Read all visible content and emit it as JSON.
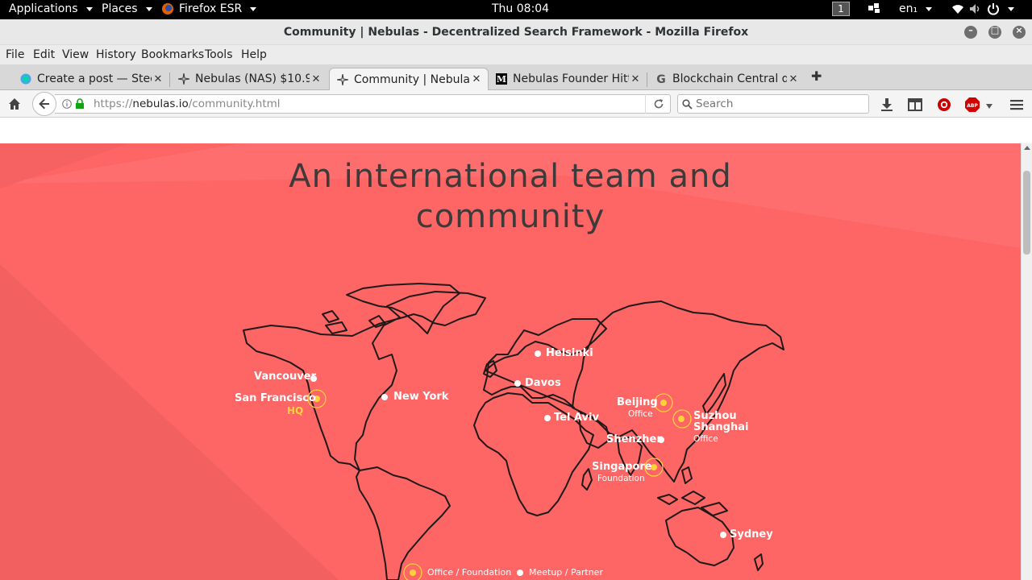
{
  "system_bar": {
    "applications": "Applications",
    "places": "Places",
    "firefox": "Firefox ESR",
    "clock": "Thu 08:04",
    "workspace": "1",
    "language": "en₁"
  },
  "window": {
    "title": "Community | Nebulas - Decentralized Search Framework - Mozilla Firefox"
  },
  "menu": [
    "File",
    "Edit",
    "View",
    "History",
    "Bookmarks",
    "Tools",
    "Help"
  ],
  "tabs": [
    {
      "label": "Create a post — Stee…",
      "icon": "steemit-icon"
    },
    {
      "label": "Nebulas (NAS) $10.9…",
      "icon": "nebulas-icon"
    },
    {
      "label": "Community | Nebulas…",
      "icon": "nebulas-icon",
      "active": true
    },
    {
      "label": "Nebulas Founder Hitt…",
      "icon": "medium-icon"
    },
    {
      "label": "Blockchain Central du…",
      "icon": "google-icon"
    }
  ],
  "navigation": {
    "url_prefix": "https://",
    "url_host": "nebulas.io",
    "url_path": "/community.html",
    "search_placeholder": "Search"
  },
  "page": {
    "heading_line1": "An international team and",
    "heading_line2": "community",
    "cities": {
      "vancouver": "Vancouver",
      "san_francisco": "San Francisco",
      "san_francisco_tag": "HQ",
      "new_york": "New York",
      "helsinki": "Helsinki",
      "davos": "Davos",
      "tel_aviv": "Tel Aviv",
      "beijing": "Beijing",
      "beijing_tag": "Office",
      "suzhou": "Suzhou",
      "shanghai": "Shanghai",
      "shanghai_tag": "Office",
      "shenzhen": "Shenzhen",
      "singapore": "Singapore",
      "singapore_tag": "Foundation",
      "sydney": "Sydney"
    },
    "legend": {
      "office": "Office / Foundation",
      "meetup": "Meetup / Partner"
    }
  },
  "colors": {
    "hero_background": "#fe6565",
    "office_marker": "#ffd23a",
    "map_outline": "#1f1a1a",
    "heading": "#3e3a3a"
  }
}
